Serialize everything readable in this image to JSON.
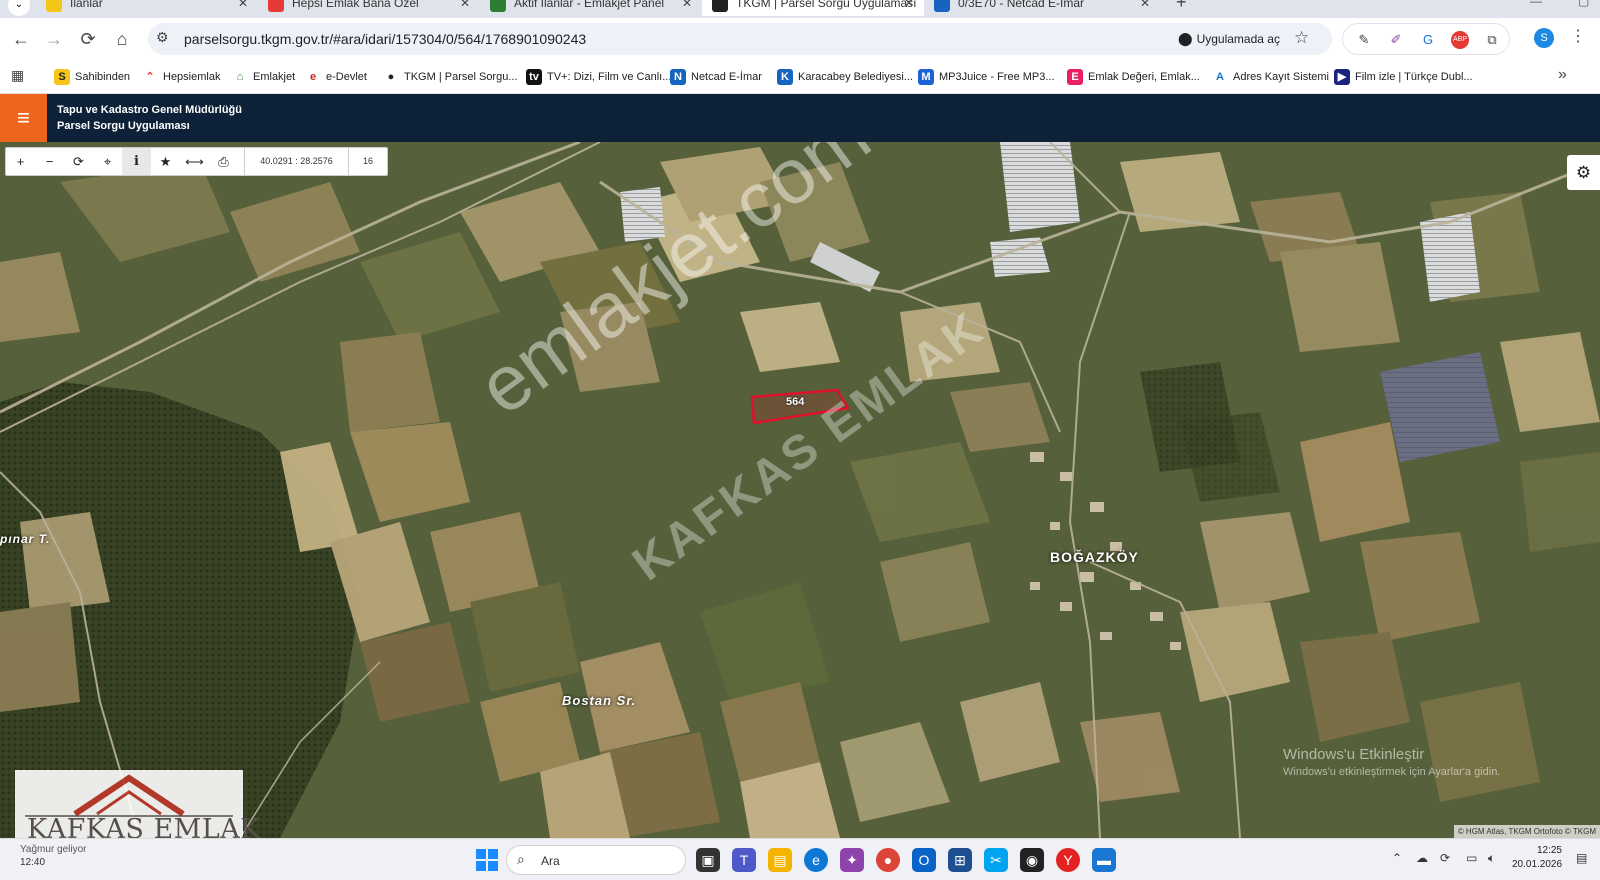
{
  "browser": {
    "tab_menu": "⌄",
    "tabs": [
      {
        "label": "İlanlar",
        "favicon_color": "#f5c518",
        "favicon_letter": "S",
        "active": false
      },
      {
        "label": "Hepsi Emlak Bana Özel",
        "favicon_color": "#e53935",
        "favicon_letter": "✕",
        "active": false
      },
      {
        "label": "Aktif İlanlar - Emlakjet Panel",
        "favicon_color": "#2e7d32",
        "favicon_letter": "⌂",
        "active": false
      },
      {
        "label": "TKGM | Parsel Sorgu Uygulaması",
        "favicon_color": "#222222",
        "favicon_letter": "●",
        "active": true
      },
      {
        "label": "0/3E70 - Netcad E-İmar",
        "favicon_color": "#1565c0",
        "favicon_letter": "N",
        "active": false
      }
    ],
    "url": "parselsorgu.tkgm.gov.tr/#ara/idari/157304/0/564/1768901090243",
    "open_in_app_label": "Uygulamada aç",
    "profile_initial": "S",
    "bookmarks": [
      {
        "label": "Sahibinden",
        "icon": "S",
        "color": "#f5c518",
        "fg": "#222"
      },
      {
        "label": "Hepsiemlak",
        "icon": "⌃",
        "color": "#ffffff",
        "fg": "#e53935"
      },
      {
        "label": "Emlakjet",
        "icon": "⌂",
        "color": "#ffffff",
        "fg": "#2e7d32"
      },
      {
        "label": "e-Devlet",
        "icon": "e",
        "color": "#ffffff",
        "fg": "#c62828"
      },
      {
        "label": "TKGM | Parsel Sorgu...",
        "icon": "●",
        "color": "#ffffff",
        "fg": "#222"
      },
      {
        "label": "TV+: Dizi, Film ve Canlı...",
        "icon": "tv",
        "color": "#111111",
        "fg": "#fff"
      },
      {
        "label": "Netcad E-İmar",
        "icon": "N",
        "color": "#1565c0",
        "fg": "#fff"
      },
      {
        "label": "Karacabey Belediyesi...",
        "icon": "K",
        "color": "#1565c0",
        "fg": "#fff"
      },
      {
        "label": "MP3Juice - Free MP3...",
        "icon": "M",
        "color": "#1e63d6",
        "fg": "#fff"
      },
      {
        "label": "Emlak Değeri, Emlak...",
        "icon": "E",
        "color": "#e91e63",
        "fg": "#fff"
      },
      {
        "label": "Adres Kayıt Sistemi",
        "icon": "A",
        "color": "#ffffff",
        "fg": "#1976d2"
      },
      {
        "label": "Film izle | Türkçe Dubl...",
        "icon": "▶",
        "color": "#1a237e",
        "fg": "#fff"
      }
    ]
  },
  "app": {
    "title_line1": "Tapu ve Kadastro Genel Müdürlüğü",
    "title_line2": "Parsel Sorgu Uygulaması",
    "menu_icon": "≡",
    "coordinates": "40.0291 : 28.2576",
    "zoom_level": "16",
    "toolbar_icons": [
      "+",
      "−",
      "⟳",
      "⌖",
      "i",
      "★",
      "⟷",
      "⎙"
    ]
  },
  "map": {
    "parcel_number": "564",
    "place_labels": [
      {
        "text": "BOĞAZKÖY",
        "kind": "village"
      },
      {
        "text": "Bostan Sr.",
        "kind": "locality"
      },
      {
        "text": "pınar T.",
        "kind": "locality"
      }
    ],
    "attribution": "© HGM Atlas, TKGM Ortofoto © TKGM",
    "watermark_primary": "emlakjet.com",
    "watermark_secondary": "KAFKAS EMLAK",
    "watermark_logo_text": "KAFKAS EMLAK",
    "logo_roof_color": "#c0392b",
    "parcel_border_color": "#e0102a"
  },
  "system": {
    "activation_title": "Windows'u Etkinleştir",
    "activation_sub": "Windows'u etkinleştirmek için Ayarlar'a gidin.",
    "weather_text": "Yağmur geliyor",
    "weather_time": "12:40",
    "search_placeholder": "Ara",
    "clock_time": "12:25",
    "clock_date": "20.01.2026"
  }
}
